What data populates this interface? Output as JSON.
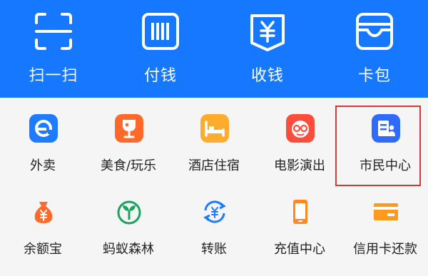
{
  "colors": {
    "topbar_bg": "#1677ff",
    "page_bg": "#f5f5f5",
    "highlight_border": "#d23a3a"
  },
  "top_actions": [
    {
      "label": "扫一扫",
      "icon": "scan-icon"
    },
    {
      "label": "付钱",
      "icon": "pay-code-icon"
    },
    {
      "label": "收钱",
      "icon": "receive-money-icon"
    },
    {
      "label": "卡包",
      "icon": "card-wallet-icon"
    }
  ],
  "services": [
    {
      "label": "外卖",
      "icon": "food-delivery-icon",
      "color": "#1e7bff"
    },
    {
      "label": "美食/玩乐",
      "icon": "wine-glass-icon",
      "color": "#ff6a2a"
    },
    {
      "label": "酒店住宿",
      "icon": "hotel-bed-icon",
      "color": "#ffab2e"
    },
    {
      "label": "电影演出",
      "icon": "movie-glasses-icon",
      "color": "#ff4d3d"
    },
    {
      "label": "市民中心",
      "icon": "citizen-card-icon",
      "color": "#2f6bff"
    },
    {
      "label": "余额宝",
      "icon": "money-bag-icon",
      "color": "#ff6a2a"
    },
    {
      "label": "蚂蚁森林",
      "icon": "sprout-icon",
      "color": "#1aa35c"
    },
    {
      "label": "转账",
      "icon": "transfer-icon",
      "color": "#1e7bff"
    },
    {
      "label": "充值中心",
      "icon": "phone-icon",
      "color": "#ff8a1f"
    },
    {
      "label": "信用卡还款",
      "icon": "credit-card-icon",
      "color": "#ff9a1f"
    }
  ]
}
